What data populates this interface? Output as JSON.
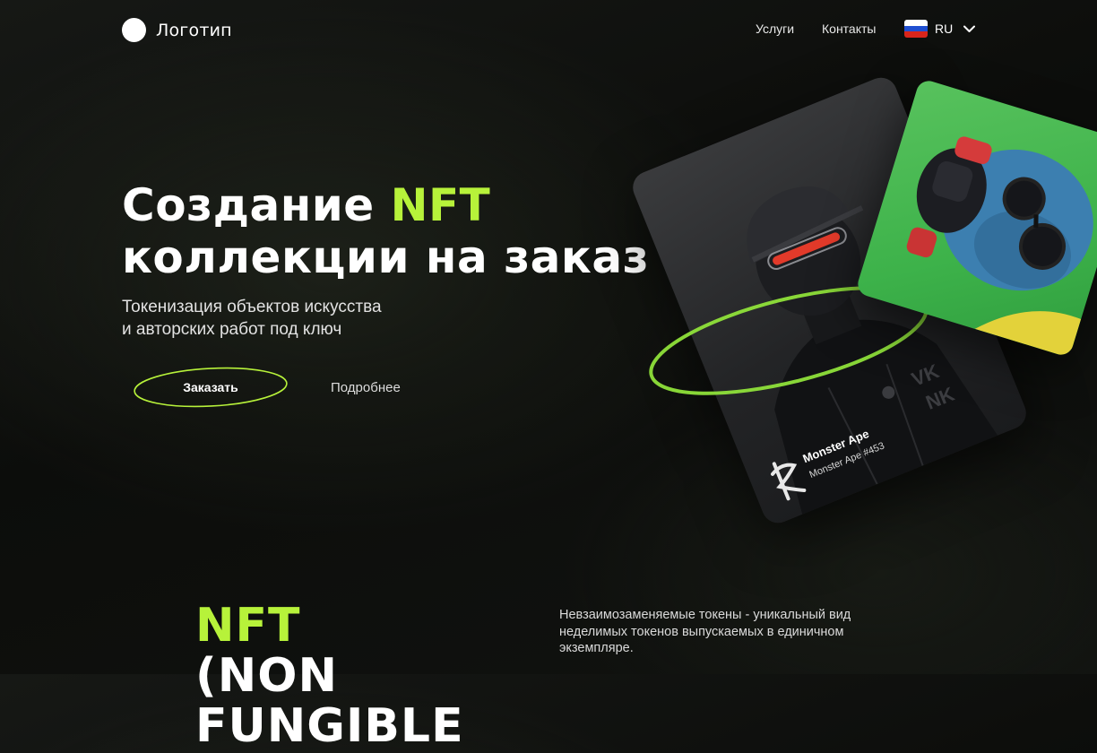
{
  "header": {
    "logo_text": "Логотип",
    "nav": {
      "services": "Услуги",
      "contacts": "Контакты"
    },
    "language": {
      "code": "RU",
      "flag_icon": "russia-flag-icon"
    }
  },
  "hero": {
    "title_line1_prefix": "Создание ",
    "title_line1_accent": "NFT",
    "title_line2": "коллекции на заказ",
    "subtitle_line1": "Токенизация объектов искусства",
    "subtitle_line2": "и авторских работ под ключ",
    "order_button": "Заказать",
    "more_link": "Подробнее"
  },
  "artwork": {
    "card_title": "Monster Ape",
    "card_subtitle": "Monster Ape #453"
  },
  "about": {
    "heading_accent": "NFT",
    "heading_rest": " (NON",
    "heading_line2": "FUNGIBLE",
    "desc_line1": "Невзаимозаменяемые токены - уникальный вид",
    "desc_line2": "неделимых токенов выпускаемых в единичном",
    "desc_line3": "экземпляре."
  },
  "colors": {
    "accent": "#b7f23a",
    "background": "#0f100e",
    "green_card": "#3db24a"
  }
}
